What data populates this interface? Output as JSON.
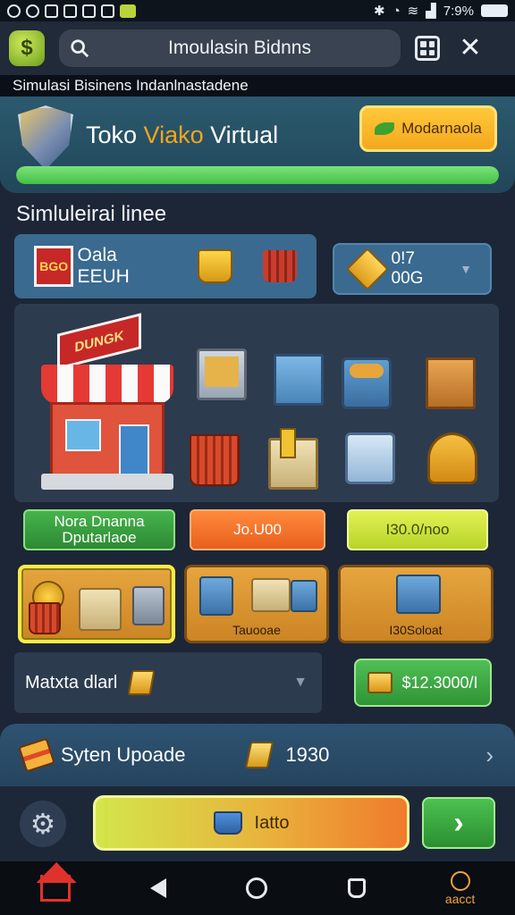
{
  "status_bar": {
    "time": "7:9%"
  },
  "header": {
    "logo_glyph": "$",
    "title": "Imoulasin Bidnns"
  },
  "subtitle": "Simulasi Bisinens Indanlnastadene",
  "store": {
    "title_prefix": "Toko ",
    "title_accent": "Viako",
    "title_suffix": " Virtual",
    "button_label": "Modarnaola",
    "progress_fraction": 1.0
  },
  "section_title": "Simluleirai linee",
  "offer": {
    "badge_text": "BGO",
    "label": "Oala EEUH",
    "balance": "0!7 00G"
  },
  "price_buttons": [
    {
      "line1": "Nora Dnanna",
      "line2": "Dputarlaoe"
    },
    {
      "line1": "Jo.U00",
      "line2": ""
    },
    {
      "line1": "I30.0/noo",
      "line2": ""
    }
  ],
  "bundles": [
    {
      "label": ""
    },
    {
      "label": "Tauooae"
    },
    {
      "label": "I30Soloat"
    }
  ],
  "storefront_sign": "DUNGK",
  "daily": {
    "label": "Matxta dlarl",
    "value": "$12.3000/I"
  },
  "upgrade": {
    "label": "Syten Upoade",
    "value": "1930"
  },
  "action": {
    "settings_glyph": "⚙",
    "launch_label": "Iatto",
    "next_glyph": "›"
  },
  "navbar": {
    "brand_text": "aacct"
  },
  "colors": {
    "background": "#1c2636",
    "accent_orange": "#f4a61d",
    "accent_green": "#43c046",
    "accent_lime": "#b8d42a"
  }
}
